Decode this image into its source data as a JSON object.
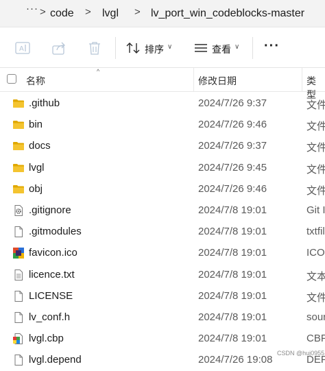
{
  "breadcrumb": {
    "more": "···",
    "items": [
      "code",
      "lvgl",
      "lv_port_win_codeblocks-master"
    ],
    "separator": ">"
  },
  "toolbar": {
    "sort_label": "排序",
    "view_label": "查看",
    "more_label": "···",
    "caret": "∨"
  },
  "columns": {
    "name": "名称",
    "date": "修改日期",
    "type": "类型",
    "sort_indicator": "^"
  },
  "rows": [
    {
      "name": ".github",
      "date": "2024/7/26 9:37",
      "type": "文件",
      "icon": "folder-icon"
    },
    {
      "name": "bin",
      "date": "2024/7/26 9:46",
      "type": "文件",
      "icon": "folder-icon"
    },
    {
      "name": "docs",
      "date": "2024/7/26 9:37",
      "type": "文件",
      "icon": "folder-icon"
    },
    {
      "name": "lvgl",
      "date": "2024/7/26 9:45",
      "type": "文件",
      "icon": "folder-icon"
    },
    {
      "name": "obj",
      "date": "2024/7/26 9:46",
      "type": "文件",
      "icon": "folder-icon"
    },
    {
      "name": ".gitignore",
      "date": "2024/7/8 19:01",
      "type": "Git I",
      "icon": "gear-file-icon"
    },
    {
      "name": ".gitmodules",
      "date": "2024/7/8 19:01",
      "type": "txtfil",
      "icon": "blank-file-icon"
    },
    {
      "name": "favicon.ico",
      "date": "2024/7/8 19:01",
      "type": "ICO",
      "icon": "image-file-icon"
    },
    {
      "name": "licence.txt",
      "date": "2024/7/8 19:01",
      "type": "文本",
      "icon": "text-file-icon"
    },
    {
      "name": "LICENSE",
      "date": "2024/7/8 19:01",
      "type": "文件",
      "icon": "blank-file-icon"
    },
    {
      "name": "lv_conf.h",
      "date": "2024/7/8 19:01",
      "type": "sour",
      "icon": "blank-file-icon"
    },
    {
      "name": "lvgl.cbp",
      "date": "2024/7/8 19:01",
      "type": "CBP",
      "icon": "codeblocks-file-icon"
    },
    {
      "name": "lvgl.depend",
      "date": "2024/7/26 19:08",
      "type": "DEP",
      "icon": "blank-file-icon"
    }
  ],
  "watermark": "CSDN @huj0955",
  "colors": {
    "folder": "#f4c430",
    "folder_dark": "#e0a800",
    "accent_blue": "#3a7bd5"
  }
}
